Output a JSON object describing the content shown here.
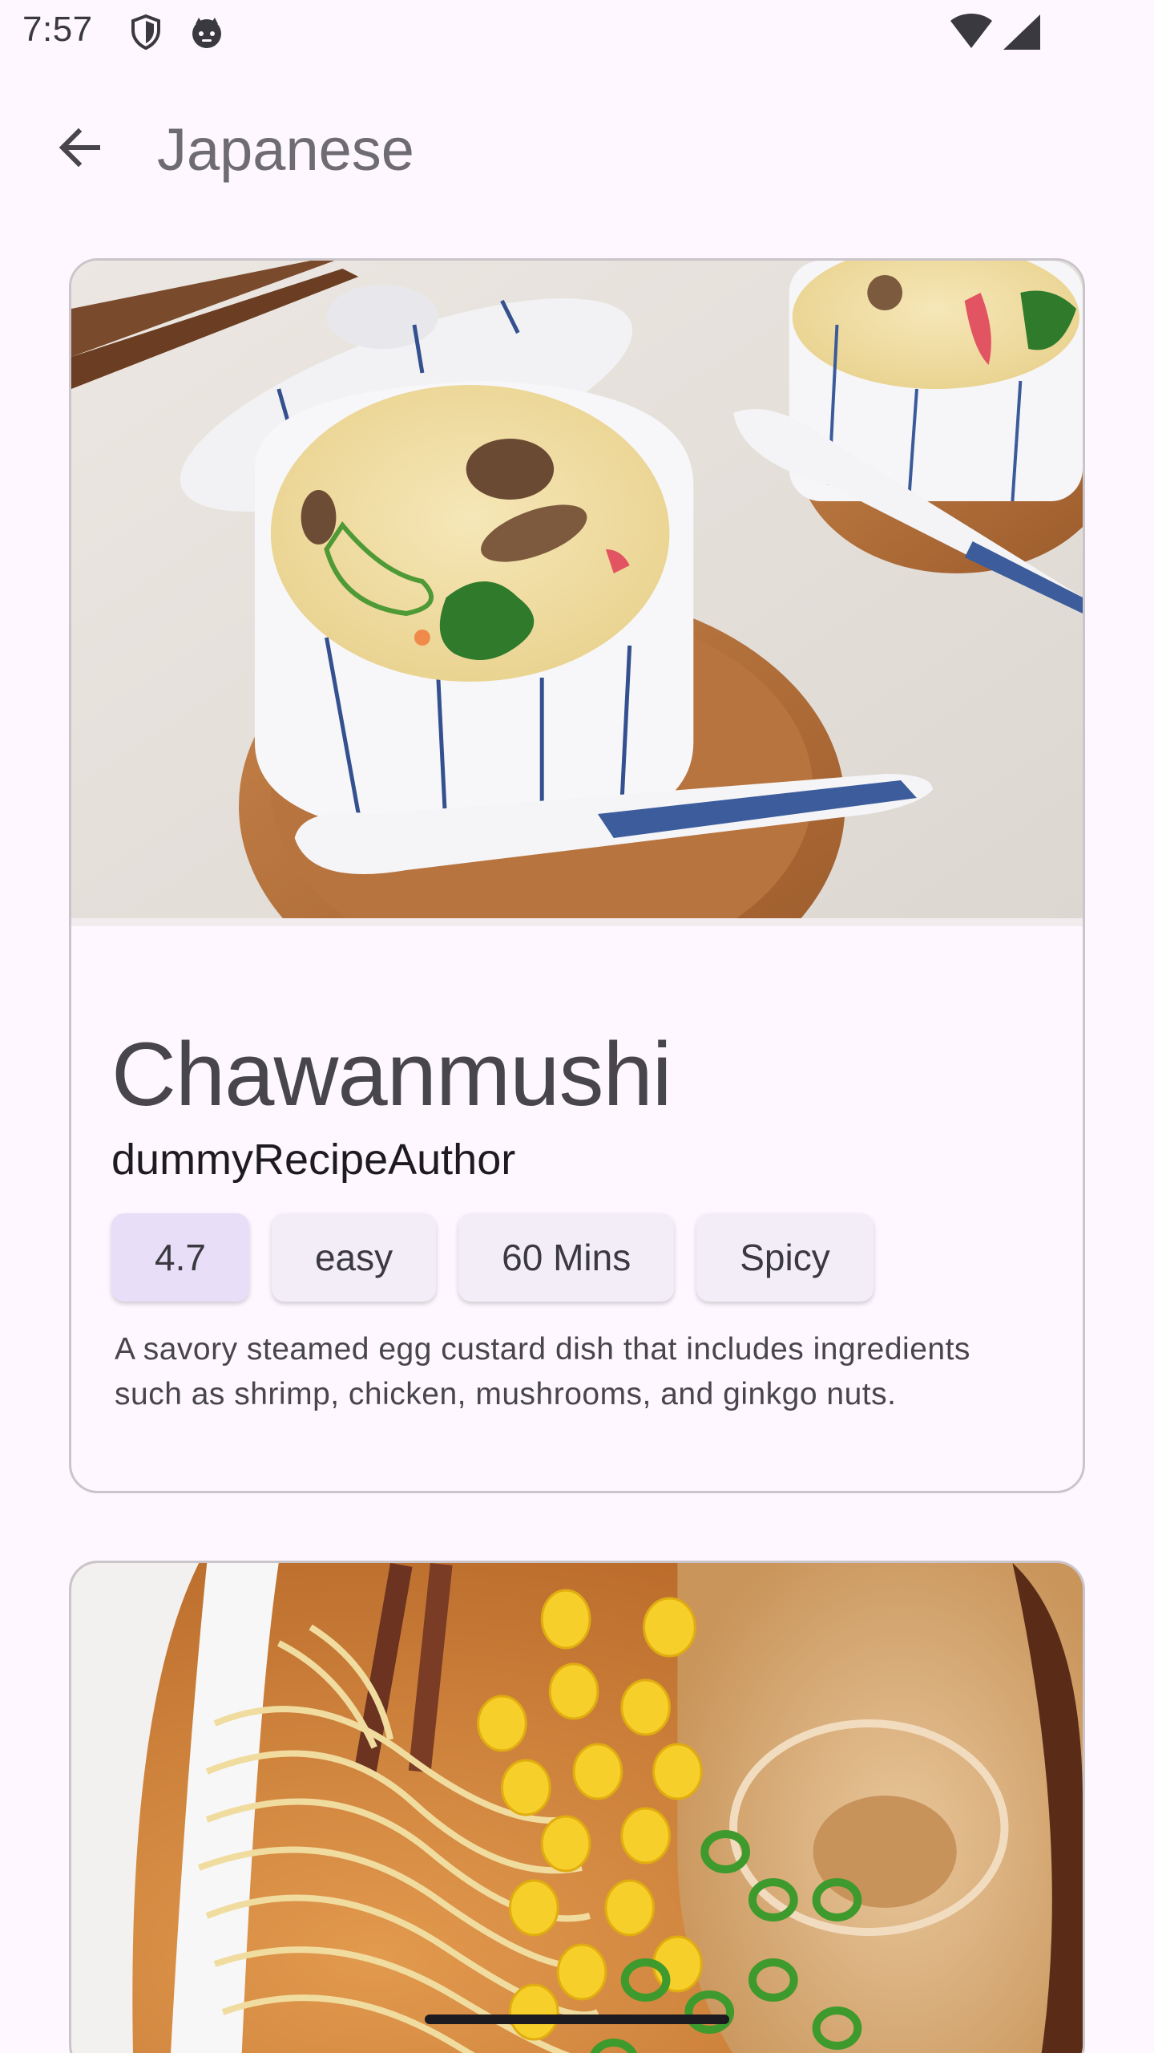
{
  "status_bar": {
    "time": "7:57",
    "icons": [
      "shield-icon",
      "robot-face-icon",
      "wifi-icon",
      "cellular-signal-icon"
    ]
  },
  "app_bar": {
    "title": "Japanese",
    "back_icon": "arrow-back-icon"
  },
  "recipes": [
    {
      "title": "Chawanmushi",
      "author": "dummyRecipeAuthor",
      "rating": "4.7",
      "difficulty": "easy",
      "duration": "60 Mins",
      "flavor": "Spicy",
      "description": "A savory steamed egg custard dish that includes ingredients such as shrimp, chicken, mushrooms, and ginkgo nuts.",
      "image": "chawanmushi-photo"
    },
    {
      "image": "ramen-photo"
    }
  ],
  "colors": {
    "background": "#fef7ff",
    "card_border": "#c9c5cb",
    "chip": "#f3edf7",
    "chip_selected": "#e8def8",
    "title_text": "#48454d"
  }
}
